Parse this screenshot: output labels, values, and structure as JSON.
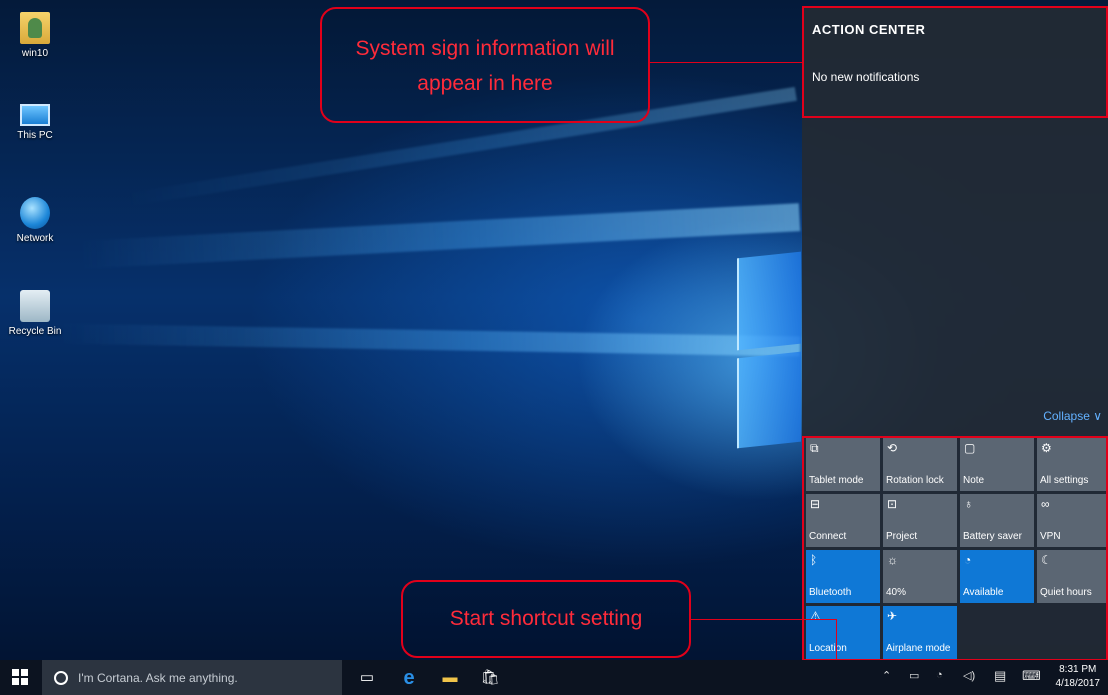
{
  "desktop": {
    "icons": [
      {
        "label": "win10",
        "icon": "user-folder-icon"
      },
      {
        "label": "This PC",
        "icon": "computer-icon"
      },
      {
        "label": "Network",
        "icon": "network-globe-icon"
      },
      {
        "label": "Recycle Bin",
        "icon": "recycle-bin-icon"
      }
    ]
  },
  "action_center": {
    "title": "ACTION CENTER",
    "empty_message": "No new notifications",
    "collapse_label": "Collapse ∨",
    "tiles": [
      {
        "label": "Tablet mode",
        "icon": "⧉",
        "on": false
      },
      {
        "label": "Rotation lock",
        "icon": "⟲",
        "on": false
      },
      {
        "label": "Note",
        "icon": "▢",
        "on": false
      },
      {
        "label": "All settings",
        "icon": "⚙",
        "on": false
      },
      {
        "label": "Connect",
        "icon": "⊟",
        "on": false
      },
      {
        "label": "Project",
        "icon": "⊡",
        "on": false
      },
      {
        "label": "Battery saver",
        "icon": "♁",
        "on": false
      },
      {
        "label": "VPN",
        "icon": "∞",
        "on": false
      },
      {
        "label": "Bluetooth",
        "icon": "ᛒ",
        "on": true
      },
      {
        "label": "40%",
        "icon": "☼",
        "on": false
      },
      {
        "label": "Available",
        "icon": "◔",
        "on": true
      },
      {
        "label": "Quiet hours",
        "icon": "☾",
        "on": false
      },
      {
        "label": "Location",
        "icon": "⚠",
        "on": true
      },
      {
        "label": "Airplane mode",
        "icon": "✈",
        "on": true
      }
    ]
  },
  "annotations": {
    "system_callout": "System sign information will appear in here",
    "shortcut_callout": "Start shortcut setting"
  },
  "taskbar": {
    "search_placeholder": "I'm Cortana. Ask me anything.",
    "time": "8:31 PM",
    "date": "4/18/2017"
  },
  "colors": {
    "accent": "#0f78d6",
    "tile_off": "#5b6673",
    "annotation_red": "#e1001a"
  }
}
